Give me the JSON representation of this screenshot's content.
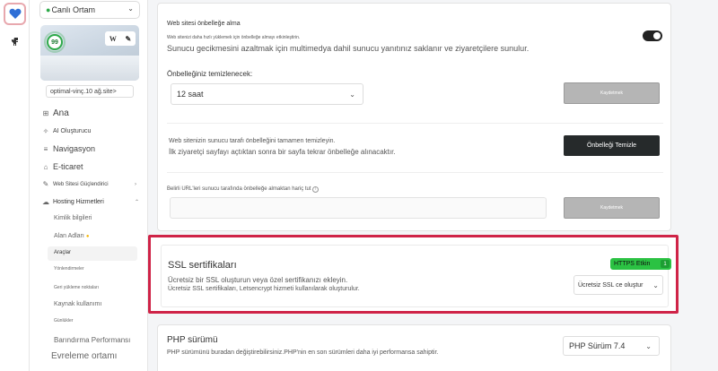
{
  "sidebar": {
    "environment": "Canlı Ortam",
    "score": "99",
    "wp_buttons": {
      "w": "W",
      "edit": "✎"
    },
    "site_name": "optimal-vinç.10 ağ.site>",
    "nav": {
      "home": "Ana",
      "ai_builder": "AI Oluşturucu",
      "navigation": "Navigasyon",
      "ecommerce": "E-ticaret",
      "site_booster": "Web Sitesi Güçlendirici",
      "hosting": "Hosting Hizmetleri"
    },
    "hosting_sub": {
      "credentials": "Kimlik bilgileri",
      "domains": "Alan Adları",
      "tools": "Araçlar",
      "redirects": "Yönlendirmeler",
      "restore": "Geri yükleme noktaları",
      "resource_usage": "Kaynak kullanımı",
      "logs": "Günlükler",
      "hosting_performance": "Barındırma Performansı",
      "staging": "Evreleme ortamı"
    }
  },
  "cache": {
    "title": "Web sitesi önbelleğe alma",
    "hint": "Web sitenizi daha hızlı yüklemek için önbelleğe almayı etkinleştirin.",
    "description": "Sunucu gecikmesini azaltmak için multimedya dahil sunucu yanıtınız saklanır ve ziyaretçilere sunulur.",
    "clear_interval_label": "Önbelleğiniz temizlenecek:",
    "clear_interval_value": "12 saat",
    "save_label": "Kaydetmek",
    "purge_line1": "Web sitenizin sunucu tarafı önbelleğini tamamen temizleyin.",
    "purge_line2": "İlk ziyaretçi sayfayı açtıktan sonra bir sayfa tekrar önbelleğe alınacaktır.",
    "purge_button": "Önbelleği Temizle",
    "exclude_label": "Belirli URL'leri sunucu tarafında önbelleğe almaktan hariç tut",
    "exclude_save": "Kaydetmek"
  },
  "ssl": {
    "title": "SSL sertifikaları",
    "line1": "Ücretsiz bir SSL oluşturun veya özel sertifikanızı ekleyin.",
    "line2": "Ücretsiz SSL sertifikaları, Letsencrypt hizmeti kullanılarak oluşturulur.",
    "badge": "HTTPS Etkin",
    "badge_count": "1",
    "select": "Ücretsiz SSL ce oluştur"
  },
  "php": {
    "title": "PHP sürümü",
    "description": "PHP sürümünü buradan değiştirebilirsiniz.PHP'nin en son sürümleri daha iyi performansa sahiptir.",
    "select": "PHP Sürüm 7.4"
  },
  "colors": {
    "accent_red": "#cf2347",
    "success_green": "#2bc243",
    "brand_blue": "#2f6fd6"
  }
}
